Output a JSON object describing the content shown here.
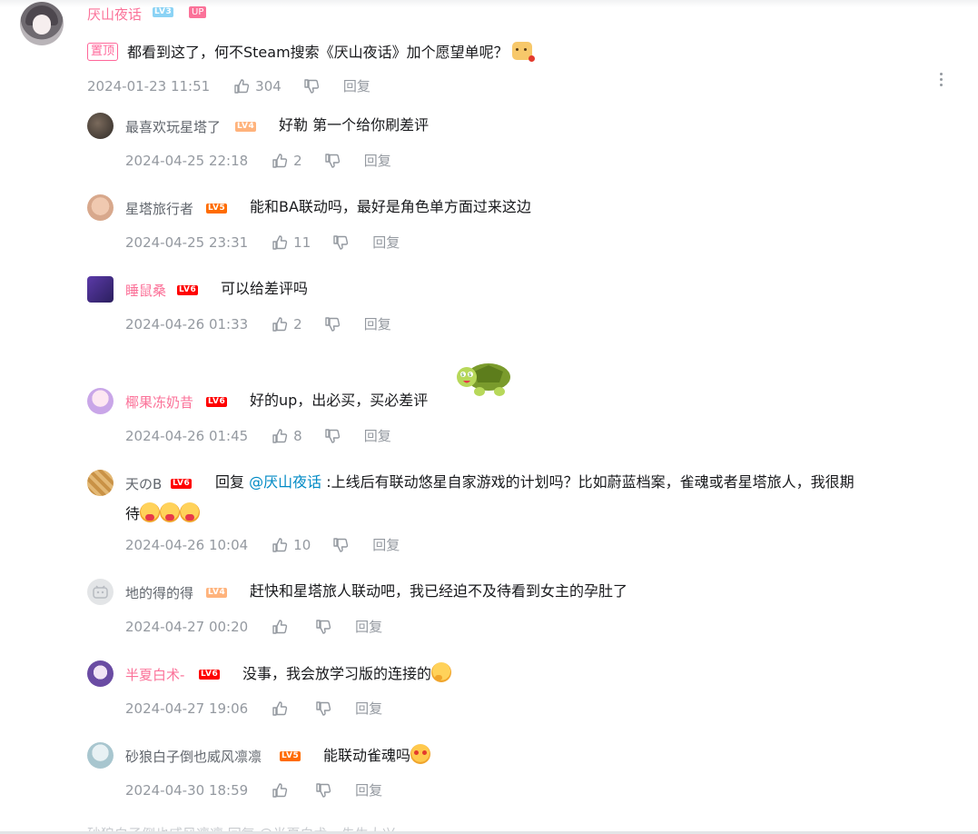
{
  "root": {
    "username": "厌山夜话",
    "level": "LV3",
    "up_badge": "UP",
    "pinned_tag": "置顶",
    "text": "都看到这了，何不Steam搜索《厌山夜话》加个愿望单呢？",
    "time": "2024-01-23 11:51",
    "likes": "304",
    "reply_label": "回复"
  },
  "replies": [
    {
      "username": "最喜欢玩星塔了",
      "level": "LV4",
      "text": "好勒 第一个给你刷差评",
      "time": "2024-04-25 22:18",
      "likes": "2",
      "reply_label": "回复"
    },
    {
      "username": "星塔旅行者",
      "level": "LV5",
      "text": "能和BA联动吗，最好是角色单方面过来这边",
      "time": "2024-04-25 23:31",
      "likes": "11",
      "reply_label": "回复"
    },
    {
      "username": "睡鼠桑",
      "level": "LV6",
      "text": "可以给差评吗",
      "time": "2024-04-26 01:33",
      "likes": "2",
      "reply_label": "回复"
    },
    {
      "username": "椰果冻奶昔",
      "level": "LV6",
      "text": "好的up，出必买，买必差评",
      "time": "2024-04-26 01:45",
      "likes": "8",
      "reply_label": "回复"
    },
    {
      "username": "天のB",
      "level": "LV6",
      "reply_prefix": "回复 ",
      "at_user": "@厌山夜话",
      "text_line1": " :上线后有联动悠星自家游戏的计划吗？比如蔚蓝档案，雀魂或者星塔旅人，我很期",
      "text_line2": "待",
      "time": "2024-04-26 10:04",
      "likes": "10",
      "reply_label": "回复"
    },
    {
      "username": "地的得的得",
      "level": "LV4",
      "text": "赶快和星塔旅人联动吧，我已经迫不及待看到女主的孕肚了",
      "time": "2024-04-27 00:20",
      "likes": "",
      "reply_label": "回复"
    },
    {
      "username": "半夏白术-",
      "level": "LV6",
      "text": "没事，我会放学习版的连接的",
      "time": "2024-04-27 19:06",
      "likes": "",
      "reply_label": "回复"
    },
    {
      "username": "砂狼白子倒也威风凛凛",
      "level": "LV5",
      "text": "能联动雀魂吗",
      "time": "2024-04-30 18:59",
      "likes": "",
      "reply_label": "回复"
    }
  ],
  "bottom_peek": "砂狼白子倒也威风凛凛    回复 @半夏白术-: 先生大兴",
  "colors": {
    "up_pink": "#fb7299",
    "meta_grey": "#9499a0",
    "at_blue": "#008ac5",
    "lv3": "#8bd3f5",
    "lv4": "#ffb37c",
    "lv5": "#ff6c00",
    "lv6": "#ff0000"
  }
}
